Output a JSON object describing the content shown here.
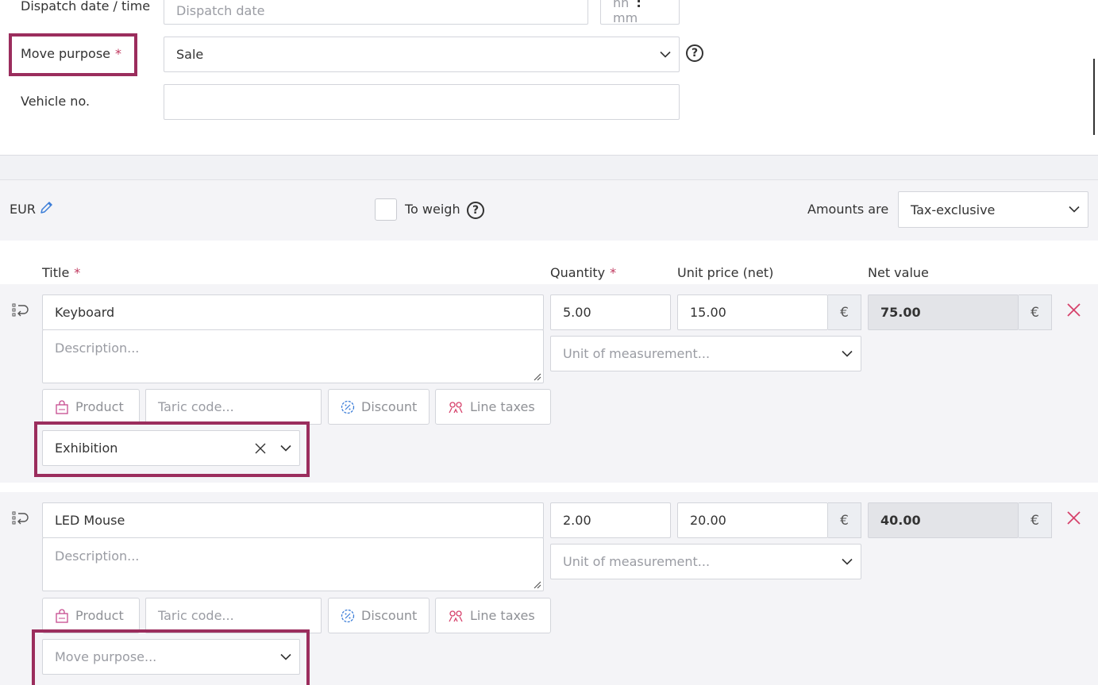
{
  "header_form": {
    "dispatch_label": "Dispatch date / time",
    "dispatch_date_placeholder": "Dispatch date",
    "time_hh": "hh",
    "time_sep": ":",
    "time_mm": "mm",
    "move_purpose_label": "Move purpose",
    "required_mark": "*",
    "move_purpose_value": "Sale",
    "help_mark": "?",
    "vehicle_label": "Vehicle no.",
    "vehicle_value": ""
  },
  "toolbar": {
    "currency": "EUR",
    "to_weigh_label": "To weigh",
    "amounts_are_label": "Amounts are",
    "amounts_mode": "Tax-exclusive"
  },
  "columns": {
    "title": "Title",
    "quantity": "Quantity",
    "unit_price": "Unit price (net)",
    "net_value": "Net value"
  },
  "lines": [
    {
      "title": "Keyboard",
      "description_placeholder": "Description...",
      "quantity": "5.00",
      "unit_price": "15.00",
      "currency_symbol": "€",
      "net_value": "75.00",
      "unit_placeholder": "Unit of measurement...",
      "product_label": "Product",
      "taric_placeholder": "Taric code...",
      "discount_label": "Discount",
      "line_taxes_label": "Line taxes",
      "move_purpose_value": "Exhibition"
    },
    {
      "title": "LED Mouse",
      "description_placeholder": "Description...",
      "quantity": "2.00",
      "unit_price": "20.00",
      "currency_symbol": "€",
      "net_value": "40.00",
      "unit_placeholder": "Unit of measurement...",
      "product_label": "Product",
      "taric_placeholder": "Taric code...",
      "discount_label": "Discount",
      "line_taxes_label": "Line taxes",
      "move_purpose_placeholder": "Move purpose..."
    }
  ],
  "colors": {
    "highlight": "#9b2d5d",
    "required": "#c0395f",
    "delete": "#d6416b",
    "band": "#f4f4f7"
  }
}
